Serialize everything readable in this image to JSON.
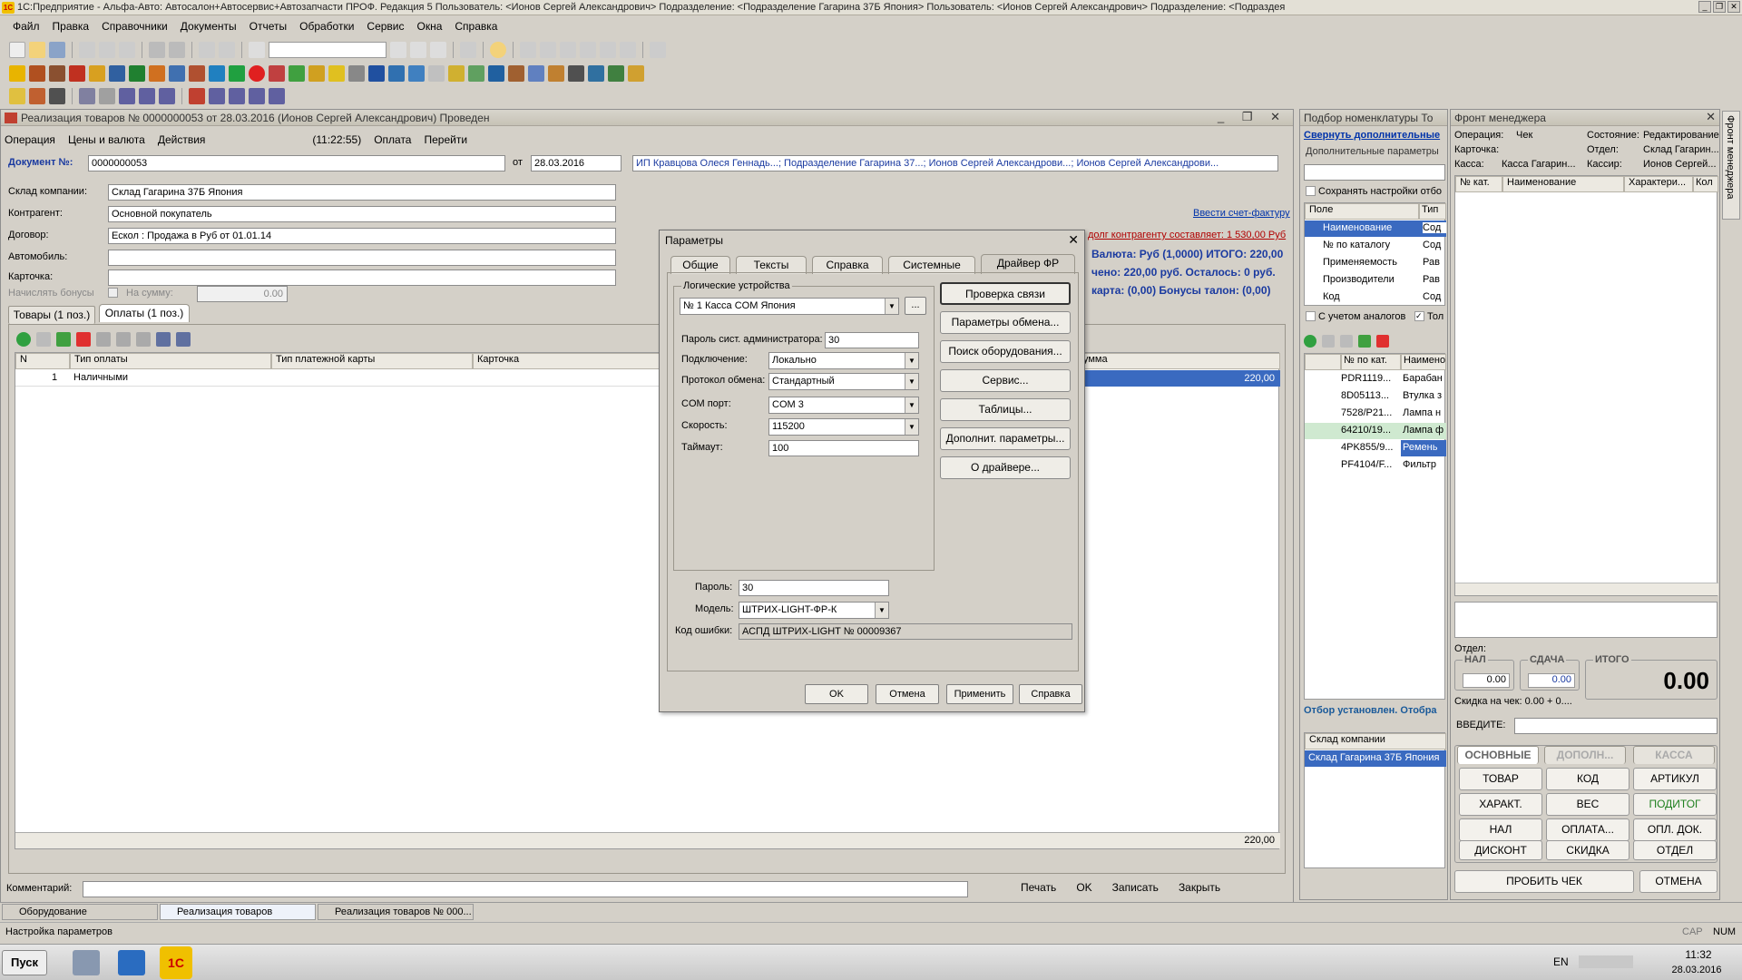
{
  "app_title": "1С:Предприятие - Альфа-Авто: Автосалон+Автосервис+Автозапчасти ПРОФ. Редакция 5   Пользователь: <Ионов Сергей Александрович>   Подразделение: <Подразделение Гагарина 37Б Япония>   Пользователь: <Ионов Сергей Александрович>   Подразделение: <Подраздея",
  "menu": [
    "Файл",
    "Правка",
    "Справочники",
    "Документы",
    "Отчеты",
    "Обработки",
    "Сервис",
    "Окна",
    "Справка"
  ],
  "doc_window": {
    "title": "Реализация товаров № 0000000053 от 28.03.2016 (Ионов Сергей Александрович) Проведен",
    "toolbar": [
      "Операция",
      "Цены и валюта",
      "Действия",
      "(11:22:55)",
      "Оплата",
      "Перейти"
    ],
    "doc_no_label": "Документ №:",
    "doc_no": "0000000053",
    "from_label": "от",
    "date": "28.03.2016",
    "org_line": "ИП Кравцова Олеся Геннадь...; Подразделение Гагарина 37...; Ионов Сергей Александрови...; Ионов Сергей Александрови...",
    "fields": [
      {
        "label": "Склад компании:",
        "value": "Склад Гагарина 37Б Япония"
      },
      {
        "label": "Контрагент:",
        "value": "Основной покупатель"
      },
      {
        "label": "Договор:",
        "value": "Ескол : Продажа в Руб от 01.01.14"
      },
      {
        "label": "Автомобиль:",
        "value": ""
      },
      {
        "label": "Карточка:",
        "value": ""
      }
    ],
    "bonus_label": "Начислять бонусы",
    "on_sum_label": "На сумму:",
    "on_sum_value": "0.00",
    "invoice_link": "Ввести счет-фактуру",
    "debt_text": "долг контрагенту составляет: 1 530,00 Руб",
    "currency_line": "Валюта: Руб (1,0000) ИТОГО: 220,00",
    "paid_line": "чено: 220,00 руб.   Осталось: 0 руб.",
    "card_line": "карта: (0,00)  Бонусы талон: (0,00)",
    "tabs": [
      "Товары (1 поз.)",
      "Оплаты (1 поз.)"
    ],
    "columns": [
      "N",
      "Тип оплаты",
      "Тип платежной карты",
      "Карточка",
      "Сумма"
    ],
    "rows": [
      {
        "n": "1",
        "type": "Наличными",
        "card_type": "",
        "card": "",
        "sum": "220,00"
      }
    ],
    "total": "220,00",
    "comment_label": "Комментарий:",
    "bottom_buttons": [
      "Печать",
      "OK",
      "Записать",
      "Закрыть"
    ]
  },
  "dialog": {
    "title": "Параметры",
    "tabs": [
      "Общие",
      "Тексты",
      "Справка",
      "Системные",
      "Драйвер ФР"
    ],
    "group_label": "Логические устройства",
    "device": "№ 1 Касса COM Япония",
    "params": [
      {
        "label": "Пароль сист. администратора:",
        "value": "30"
      },
      {
        "label": "Подключение:",
        "value": "Локально"
      },
      {
        "label": "Протокол обмена:",
        "value": "Стандартный"
      },
      {
        "label": "COM порт:",
        "value": "COM 3"
      },
      {
        "label": "Скорость:",
        "value": "115200"
      },
      {
        "label": "Таймаут:",
        "value": "100"
      }
    ],
    "right_buttons": [
      "Проверка связи",
      "Параметры обмена...",
      "Поиск оборудования...",
      "Сервис...",
      "Таблицы...",
      "Дополнит. параметры...",
      "О драйвере..."
    ],
    "password_label": "Пароль:",
    "password": "30",
    "model_label": "Модель:",
    "model": "ШТРИХ-LIGHT-ФР-К",
    "error_label": "Код ошибки:",
    "error_value": "АСПД ШТРИХ-LIGHT № 00009367",
    "footer_buttons": [
      "OK",
      "Отмена",
      "Применить",
      "Справка"
    ]
  },
  "picker": {
    "title": "Подбор номенклатуры То",
    "collapse_link": "Свернуть дополнительные",
    "extra_params": "Дополнительные параметры",
    "save_settings": "Сохранять настройки отбо",
    "field_col": "Поле",
    "type_col": "Тип",
    "field_rows": [
      {
        "name": "Наименование",
        "type": "Сод"
      },
      {
        "name": "№ по каталогу",
        "type": "Сод"
      },
      {
        "name": "Применяемость",
        "type": "Рав"
      },
      {
        "name": "Производители",
        "type": "Рав"
      },
      {
        "name": "Код",
        "type": "Сод"
      }
    ],
    "analogs": "С учетом аналогов",
    "only": "Тол",
    "cat_col": "№ по кат.",
    "name_col": "Наимено",
    "items": [
      {
        "cat": "PDR1119...",
        "name": "Барабан"
      },
      {
        "cat": "8D05113...",
        "name": "Втулка з"
      },
      {
        "cat": "7528/P21...",
        "name": "Лампа н"
      },
      {
        "cat": "64210/19...",
        "name": "Лампа ф"
      },
      {
        "cat": "4PK855/9...",
        "name": "Ремень"
      },
      {
        "cat": "PF4104/F...",
        "name": "Фильтр"
      }
    ],
    "filter_set": "Отбор установлен. Отобра",
    "warehouse_col": "Склад компании",
    "warehouse": "Склад Гагарина 37Б Япония"
  },
  "front": {
    "title": "Фронт менеджера",
    "operation_label": "Операция:",
    "operation": "Чек",
    "state_label": "Состояние:",
    "state": "Редактирование",
    "card_label": "Карточка:",
    "dept_label": "Отдел:",
    "dept": "Склад Гагарин...",
    "kassa_label": "Касса:",
    "kassa": "Касса Гагарин...",
    "cashier_label": "Кассир:",
    "cashier": "Ионов Сергей...",
    "cols": [
      "№ кат.",
      "Наименование",
      "Характери...",
      "Кол"
    ],
    "otdel": "Отдел:",
    "nal_label": "НАЛ",
    "nal": "0.00",
    "sdacha_label": "СДАЧА",
    "sdacha": "0.00",
    "itogo_label": "ИТОГО",
    "itogo": "0.00",
    "discount": "Скидка на чек: 0.00 + 0....",
    "enter_label": "ВВЕДИТЕ:",
    "tabs": [
      "ОСНОВНЫЕ",
      "ДОПОЛН...",
      "КАССА"
    ],
    "keys": [
      "ТОВАР",
      "КОД",
      "АРТИКУЛ",
      "ХАРАКТ.",
      "ВЕС",
      "ПОДИТОГ",
      "НАЛ",
      "ОПЛАТА...",
      "ОПЛ. ДОК.",
      "ДИСКОНТ",
      "СКИДКА",
      "ОТДЕЛ"
    ],
    "print_check": "ПРОБИТЬ ЧЕК",
    "cancel": "ОТМЕНА",
    "side_label": "Фронт менеджера"
  },
  "taskwins": [
    "Оборудование",
    "Реализация товаров",
    "Реализация товаров № 000..."
  ],
  "status": "Настройка параметров",
  "status_right": [
    "CAP",
    "NUM"
  ],
  "taskbar": {
    "start": "Пуск",
    "lang": "EN",
    "time": "11:32",
    "date": "28.03.2016"
  }
}
